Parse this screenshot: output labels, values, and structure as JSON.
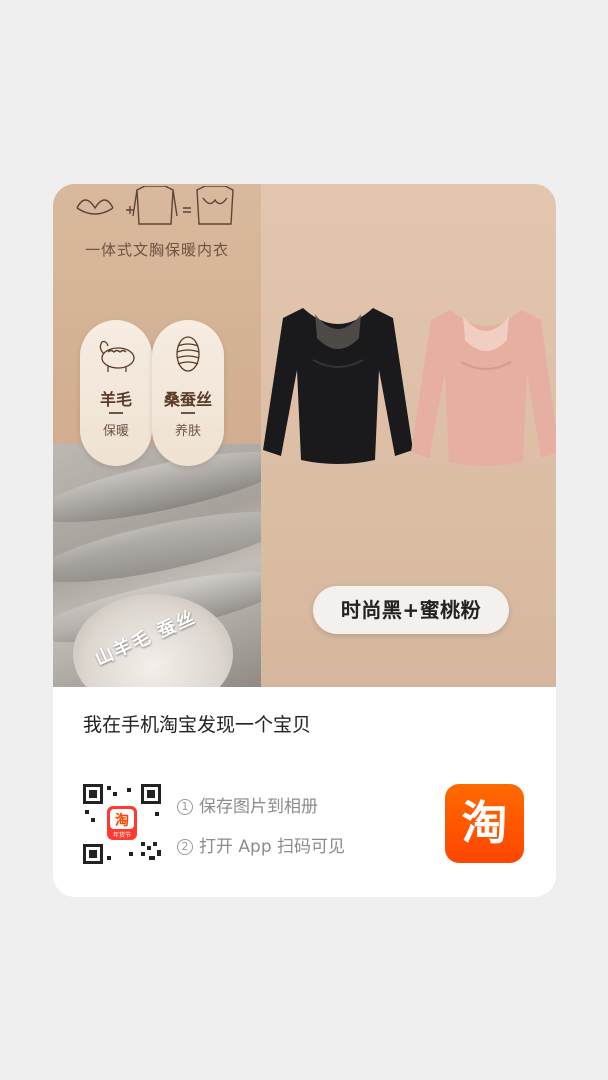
{
  "product_image": {
    "headline": "一体式文胸保暖内衣",
    "features": [
      {
        "icon": "sheep-icon",
        "title": "羊毛",
        "sub": "保暖"
      },
      {
        "icon": "silk-cocoon-icon",
        "title": "桑蚕丝",
        "sub": "养肤"
      }
    ],
    "material_label": "山羊毛 蚕丝",
    "color_badge": "时尚黑+蜜桃粉"
  },
  "share": {
    "title": "我在手机淘宝发现一个宝贝",
    "steps": [
      {
        "num": "1",
        "text": "保存图片到相册"
      },
      {
        "num": "2",
        "text": "打开 App 扫码可见"
      }
    ],
    "qr_center_label": "淘",
    "qr_center_sub": "年货节",
    "logo_text": "淘"
  },
  "colors": {
    "background": "#efefef",
    "card": "#ffffff",
    "taobao_orange": "#ff5000",
    "garment_black": "#1a1a1c",
    "garment_pink": "#e7aea2"
  }
}
